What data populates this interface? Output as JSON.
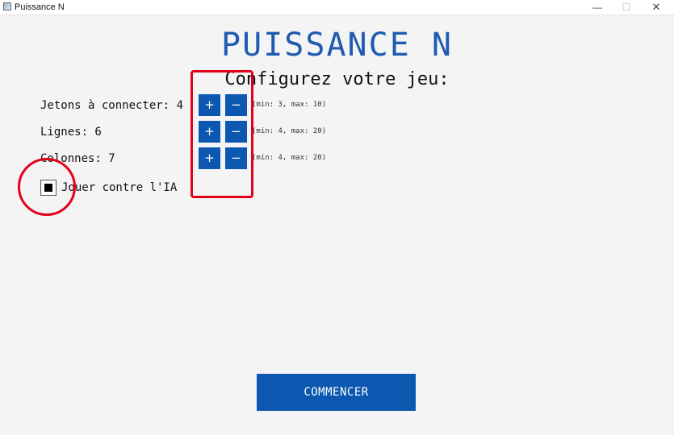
{
  "window": {
    "title": "Puissance N",
    "controls": {
      "minimize": "—",
      "maximize": "☐",
      "close": "✕"
    }
  },
  "header": {
    "title": "PUISSANCE N",
    "subtitle": "Configurez votre jeu:"
  },
  "settings": [
    {
      "label": "Jetons à connecter: 4",
      "plus": "+",
      "minus": "−",
      "range": "(min: 3, max: 10)"
    },
    {
      "label": "Lignes: 6",
      "plus": "+",
      "minus": "−",
      "range": "(min: 4, max: 20)"
    },
    {
      "label": "Colonnes: 7",
      "plus": "+",
      "minus": "−",
      "range": "(min: 4, max: 20)"
    }
  ],
  "ai_option": {
    "label": "Jouer contre l'IA",
    "checked": true
  },
  "start_button": {
    "label": "COMMENCER"
  },
  "colors": {
    "accent": "#0c57b0",
    "title": "#1f5bb0",
    "annotation": "#e3001b",
    "background": "#f4f4f4"
  }
}
